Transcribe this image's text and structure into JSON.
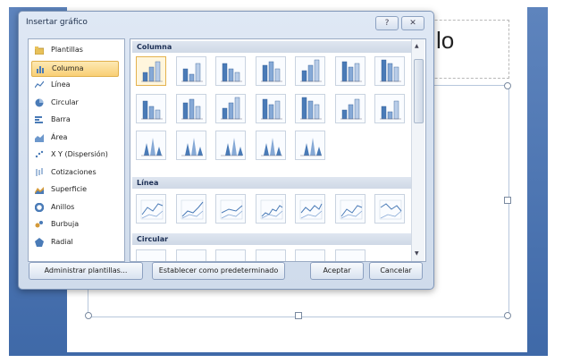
{
  "slide": {
    "title_fragment": "lo"
  },
  "dialog": {
    "title": "Insertar gráfico",
    "help_glyph": "?",
    "close_glyph": "✕",
    "categories": [
      {
        "label": "Plantillas",
        "icon": "folder-icon"
      },
      {
        "label": "Columna",
        "icon": "column-chart-icon",
        "selected": true
      },
      {
        "label": "Línea",
        "icon": "line-chart-icon"
      },
      {
        "label": "Circular",
        "icon": "pie-chart-icon"
      },
      {
        "label": "Barra",
        "icon": "bar-chart-icon"
      },
      {
        "label": "Área",
        "icon": "area-chart-icon"
      },
      {
        "label": "X Y (Dispersión)",
        "icon": "scatter-chart-icon"
      },
      {
        "label": "Cotizaciones",
        "icon": "stock-chart-icon"
      },
      {
        "label": "Superficie",
        "icon": "surface-chart-icon"
      },
      {
        "label": "Anillos",
        "icon": "doughnut-chart-icon"
      },
      {
        "label": "Burbuja",
        "icon": "bubble-chart-icon"
      },
      {
        "label": "Radial",
        "icon": "radar-chart-icon"
      }
    ],
    "sections": {
      "column": "Columna",
      "line": "Línea",
      "pie": "Circular"
    },
    "buttons": {
      "manage_templates": "Administrar plantillas...",
      "set_default": "Establecer como predeterminado",
      "ok": "Aceptar",
      "cancel": "Cancelar"
    }
  },
  "colors": {
    "accent_blue": "#4a7bb7",
    "selection_orange": "#f9cf75",
    "slide_bg": "#3f69a8"
  }
}
